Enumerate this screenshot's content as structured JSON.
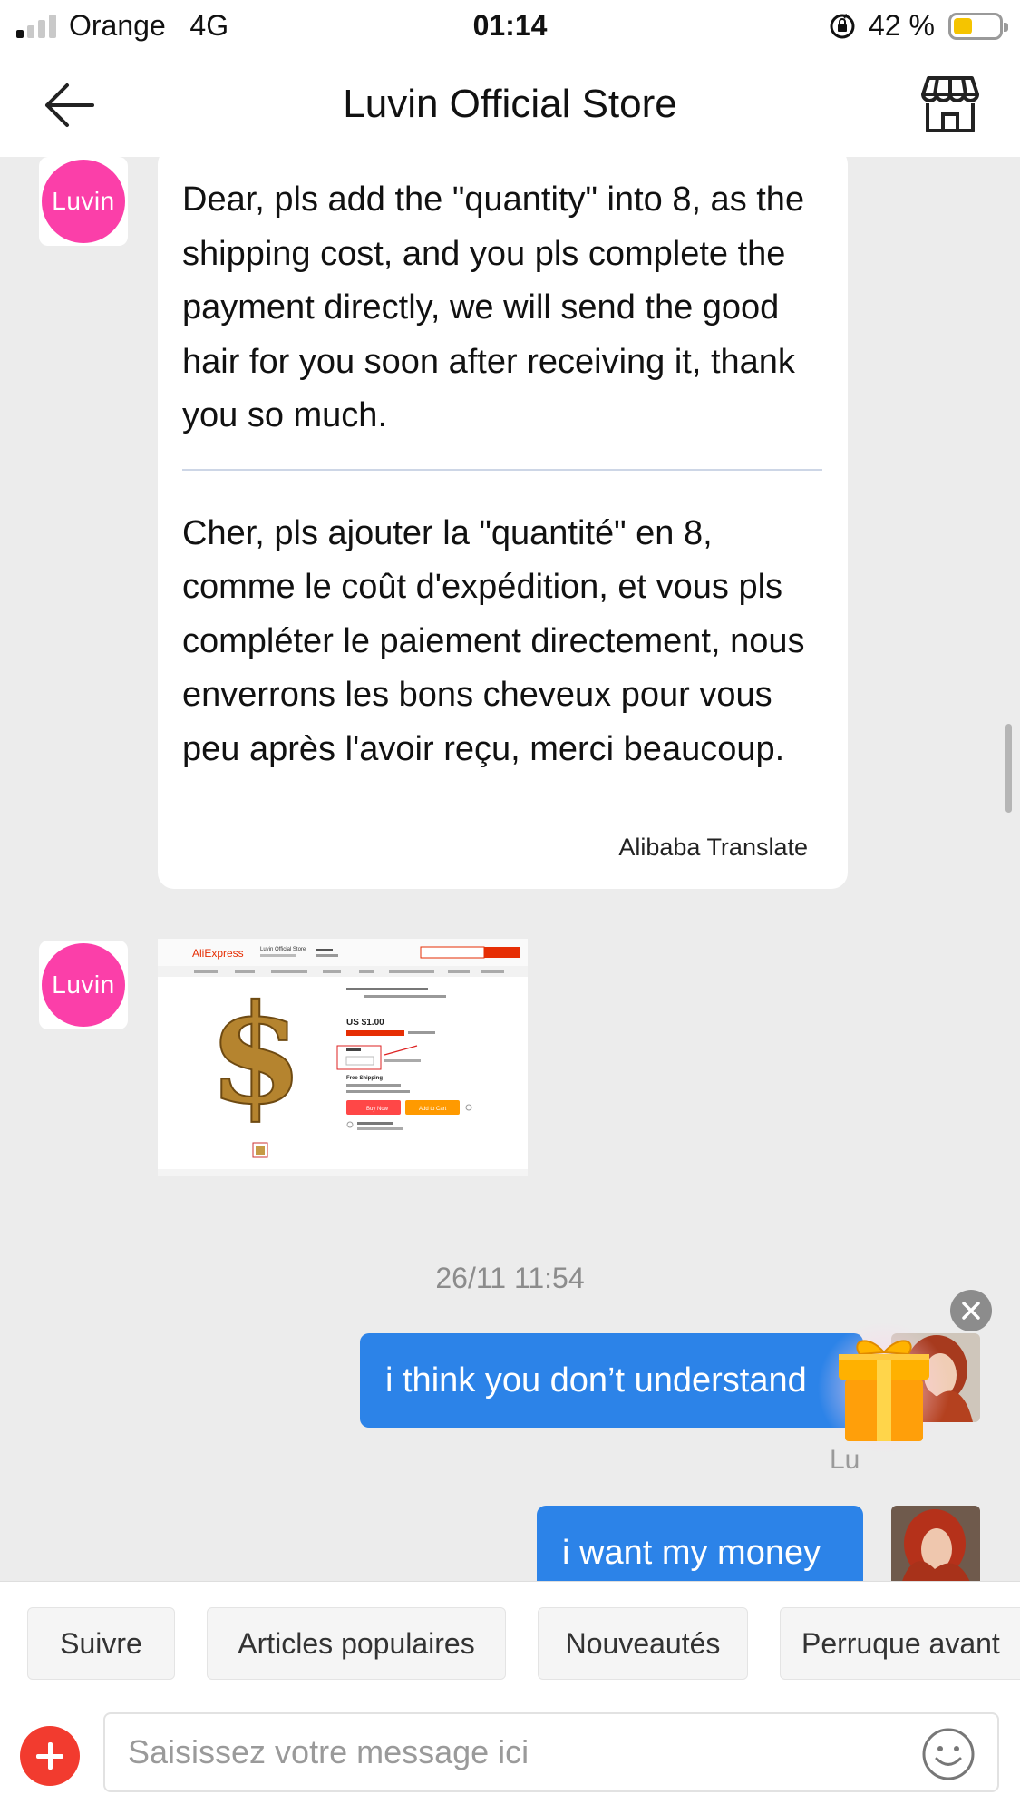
{
  "status_bar": {
    "carrier": "Orange",
    "network": "4G",
    "time": "01:14",
    "battery_percent": "42 %",
    "battery_level": 0.42
  },
  "header": {
    "title": "Luvin Official Store",
    "back_icon": "back-arrow-icon",
    "store_icon": "storefront-icon"
  },
  "store": {
    "avatar_text": "Luvin",
    "avatar_color": "#fb3fa9"
  },
  "messages": {
    "incoming_text": {
      "original": "Dear, pls add the \"quantity\" into 8, as the shipping cost, and you pls complete the payment directly, we will send the good hair for you soon after receiving it, thank you so much.",
      "translation": "Cher, pls ajouter la \"quantité\" en 8, comme le coût d'expédition, et vous pls compléter le paiement directement, nous enverrons les bons cheveux pour vous peu après l'avoir reçu, merci beaucoup.",
      "translate_credit": "Alibaba Translate"
    },
    "timestamp": "26/11 11:54",
    "outgoing": [
      {
        "text": "i think you don’t understand"
      },
      {
        "text": "i want my money"
      }
    ],
    "sender_tag": "Lu"
  },
  "product_card": {
    "brand": "AliExpress",
    "store_name": "Luvin Official Store",
    "price": "US $1.00",
    "shipping": "Free Shipping",
    "buy_label": "Buy Now",
    "cart_label": "Add to Cart",
    "dollar_sign": "$"
  },
  "quick_replies": [
    "Suivre",
    "Articles populaires",
    "Nouveautés",
    "Perruque avant"
  ],
  "input": {
    "placeholder": "Saisissez votre message ici"
  },
  "colors": {
    "accent_blue": "#2c83e8",
    "plus_red": "#f23b2f",
    "aliexpress_red": "#e62e04"
  }
}
